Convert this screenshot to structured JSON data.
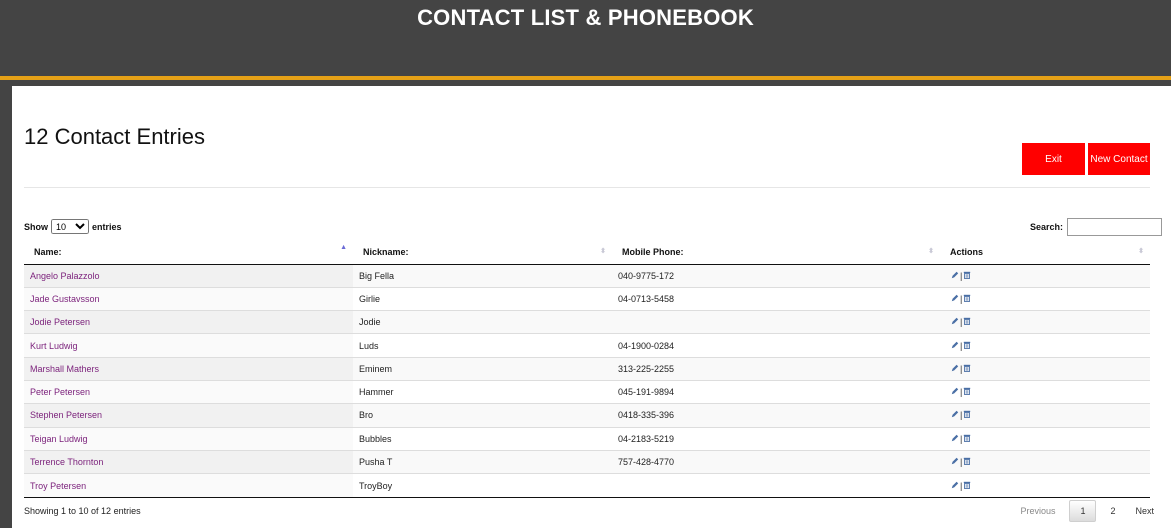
{
  "header": {
    "title": "CONTACT LIST & PHONEBOOK"
  },
  "colors": {
    "header_bg": "#444444",
    "accent": "#e5a117",
    "button": "#ff0000",
    "name_link": "#7a1f7a"
  },
  "page": {
    "title": "12 Contact Entries"
  },
  "buttons": {
    "exit": "Exit",
    "new_contact": "New Contact"
  },
  "controls": {
    "show_label": "Show",
    "entries_label": "entries",
    "length_value": "10",
    "search_label": "Search:",
    "search_value": ""
  },
  "table": {
    "headers": [
      "Name:",
      "Nickname:",
      "Mobile Phone:",
      "Actions"
    ],
    "rows": [
      {
        "name": "Angelo Palazzolo",
        "nickname": "Big Fella",
        "phone": "040-9775-172"
      },
      {
        "name": "Jade Gustavsson",
        "nickname": "Girlie",
        "phone": "04-0713-5458"
      },
      {
        "name": "Jodie Petersen",
        "nickname": "Jodie",
        "phone": ""
      },
      {
        "name": "Kurt Ludwig",
        "nickname": "Luds",
        "phone": "04-1900-0284"
      },
      {
        "name": "Marshall Mathers",
        "nickname": "Eminem",
        "phone": "313-225-2255"
      },
      {
        "name": "Peter Petersen",
        "nickname": "Hammer",
        "phone": "045-191-9894"
      },
      {
        "name": "Stephen Petersen",
        "nickname": "Bro",
        "phone": "0418-335-396"
      },
      {
        "name": "Teigan Ludwig",
        "nickname": "Bubbles",
        "phone": "04-2183-5219"
      },
      {
        "name": "Terrence Thornton",
        "nickname": "Pusha T",
        "phone": "757-428-4770"
      },
      {
        "name": "Troy Petersen",
        "nickname": "TroyBoy",
        "phone": ""
      }
    ],
    "action_icons": [
      "pencil-icon",
      "trash-icon"
    ]
  },
  "footer": {
    "info": "Showing 1 to 10 of 12 entries",
    "previous": "Previous",
    "pages": [
      "1",
      "2"
    ],
    "next": "Next"
  }
}
